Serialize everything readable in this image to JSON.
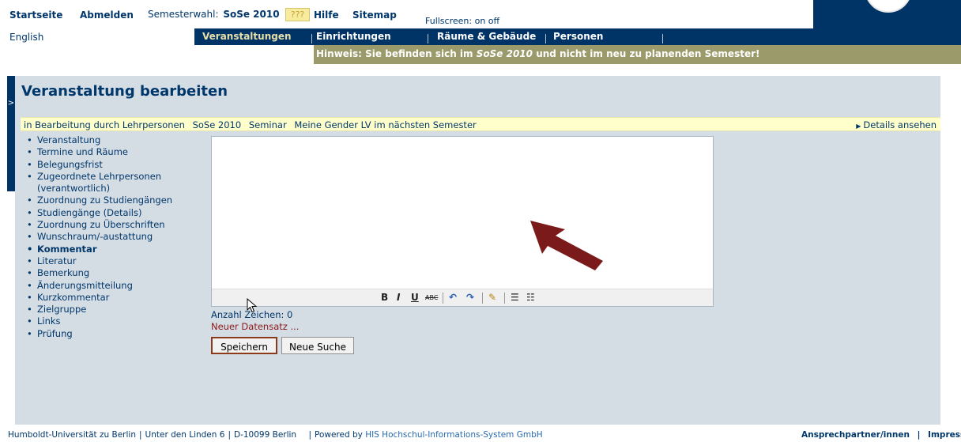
{
  "topbar": {
    "home": "Startseite",
    "logout": "Abmelden",
    "semester_label": "Semesterwahl:",
    "semester_value": "SoSe 2010",
    "badge": "???",
    "help": "Hilfe",
    "sitemap": "Sitemap",
    "fullscreen_label": "Fullscreen:",
    "fullscreen_on": "on",
    "fullscreen_off": "off"
  },
  "language": "English",
  "nav": {
    "tabs": [
      "Veranstaltungen",
      "Einrichtungen",
      "Räume & Gebäude",
      "Personen"
    ]
  },
  "notice": {
    "prefix": "Hinweis: Sie befinden sich im",
    "semester": "SoSe 2010",
    "suffix": "und nicht im neu zu planenden Semester!"
  },
  "side_tab": ">",
  "page_title": "Veranstaltung bearbeiten",
  "statusbar": {
    "crumbs": [
      "in Bearbeitung durch Lehrpersonen",
      "SoSe 2010",
      "Seminar",
      "Meine Gender LV im nächsten Semester"
    ],
    "details": "Details ansehen"
  },
  "menu": [
    "Veranstaltung",
    "Termine und Räume",
    "Belegungsfrist",
    "Zugeordnete Lehrpersonen",
    "(verantwortlich)",
    "Zuordnung zu Studiengängen",
    "Studiengänge (Details)",
    "Zuordnung zu Überschriften",
    "Wunschraum/-austattung",
    "Kommentar",
    "Literatur",
    "Bemerkung",
    "Änderungsmitteilung",
    "Kurzkommentar",
    "Zielgruppe",
    "Links",
    "Prüfung"
  ],
  "menu_active": "Kommentar",
  "editor": {
    "toolbar": [
      "B",
      "I",
      "U",
      "ABC",
      "↶",
      "↷",
      "✎",
      "☰",
      "☷"
    ]
  },
  "char_count": "Anzahl Zeichen: 0",
  "new_record": "Neuer Datensatz ...",
  "buttons": {
    "save": "Speichern",
    "new_search": "Neue Suche"
  },
  "footer": {
    "university": "Humboldt-Universität zu Berlin",
    "address": "Unter den Linden 6",
    "postal": "D-10099 Berlin",
    "powered_prefix": "Powered by",
    "powered_link": "HIS Hochschul-Informations-System GmbH",
    "contact": "Ansprechpartner/innen",
    "imprint": "Impressum"
  },
  "colors": {
    "navy": "#003366",
    "notice_bg": "#9a9a6a",
    "panel_bg": "#d4dce4",
    "status_bg": "#ffffcc",
    "arrow": "#7a1a1a"
  }
}
